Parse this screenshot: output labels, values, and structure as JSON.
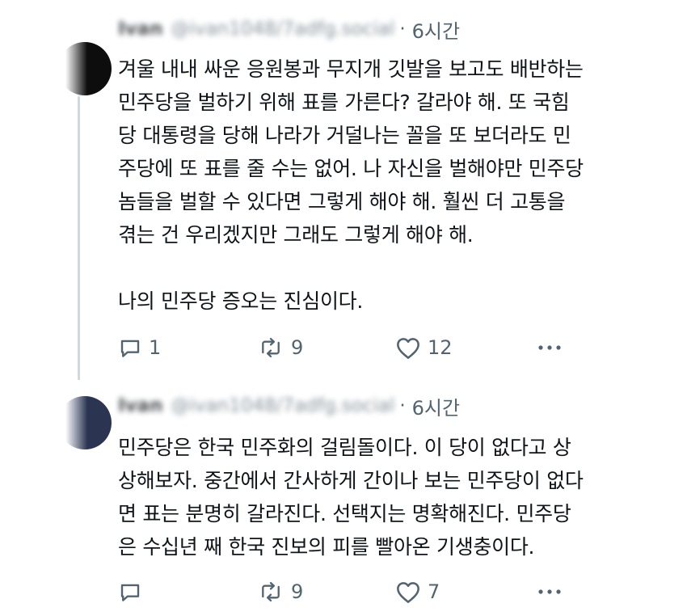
{
  "tweets": [
    {
      "author": {
        "name": "Ivan",
        "handle": "@ivan1048/7adfg.social"
      },
      "separator": "·",
      "timestamp": "6시간",
      "text": "겨울 내내 싸운 응원봉과 무지개 깃발을 보고도 배반하는\n민주당을 벌하기 위해 표를 가른다? 갈라야 해. 또 국힘\n당 대통령을 당해 나라가 거덜나는 꼴을 또 보더라도 민\n주당에 또 표를 줄 수는 없어. 나 자신을 벌해야만 민주당\n놈들을 벌할 수 있다면 그렇게 해야 해. 훨씬 더 고통을\n겪는 건 우리겠지만 그래도 그렇게 해야 해.\n\n나의 민주당 증오는 진심이다.",
      "stats": {
        "replies": "1",
        "reposts": "9",
        "likes": "12"
      },
      "icons": [
        "reply-icon",
        "repost-icon",
        "like-icon",
        "more-icon"
      ]
    },
    {
      "author": {
        "name": "Ivan",
        "handle": "@ivan1048/7adfg.social"
      },
      "separator": "·",
      "timestamp": "6시간",
      "text": "민주당은 한국 민주화의 걸림돌이다. 이 당이 없다고 상\n상해보자. 중간에서 간사하게 간이나 보는 민주당이 없다\n면 표는 분명히 갈라진다. 선택지는 명확해진다. 민주당\n은 수십년 째 한국 진보의 피를 빨아온 기생충이다.",
      "stats": {
        "replies": "",
        "reposts": "9",
        "likes": "7"
      },
      "icons": [
        "reply-icon",
        "repost-icon",
        "like-icon",
        "more-icon"
      ]
    }
  ],
  "colors": {
    "text": "#0f1419",
    "secondary": "#536471",
    "thread_line": "#cfd9de",
    "avatar_1": "#0d0d0d",
    "avatar_2": "#2b3552"
  }
}
